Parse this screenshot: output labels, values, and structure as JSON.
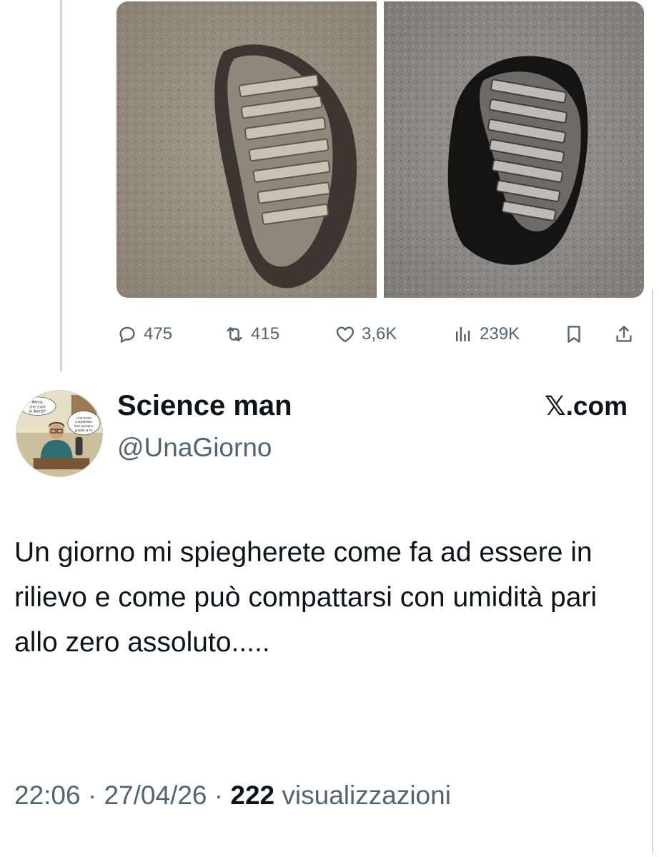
{
  "previous_tweet": {
    "media": [
      {
        "alt_icon": "moon-bootprint-photo-color"
      },
      {
        "alt_icon": "moon-bootprint-photo-gray"
      }
    ],
    "actions": {
      "replies": "475",
      "retweets": "415",
      "likes": "3,6K",
      "views": "239K"
    }
  },
  "tweet": {
    "author": {
      "display_name": "Science man",
      "handle": "@UnaGiorno",
      "avatar_bubble_1": "Alexa, che cos'è la libertà?",
      "avatar_bubble_2": "Una teoria complottista. Non pensarci, guarda la Tv."
    },
    "brand": "𝕏.com",
    "text": "Un giorno mi spiegherete come fa ad essere in rilievo e come può compattarsi con umidità pari allo zero assoluto.....",
    "time": "22:06",
    "date": "27/04/26",
    "view_count": "222",
    "view_label": "visualizzazioni",
    "separator": "·"
  },
  "colors": {
    "text_primary": "#0f1419",
    "text_secondary": "#536471",
    "divider": "#cfd9de"
  }
}
